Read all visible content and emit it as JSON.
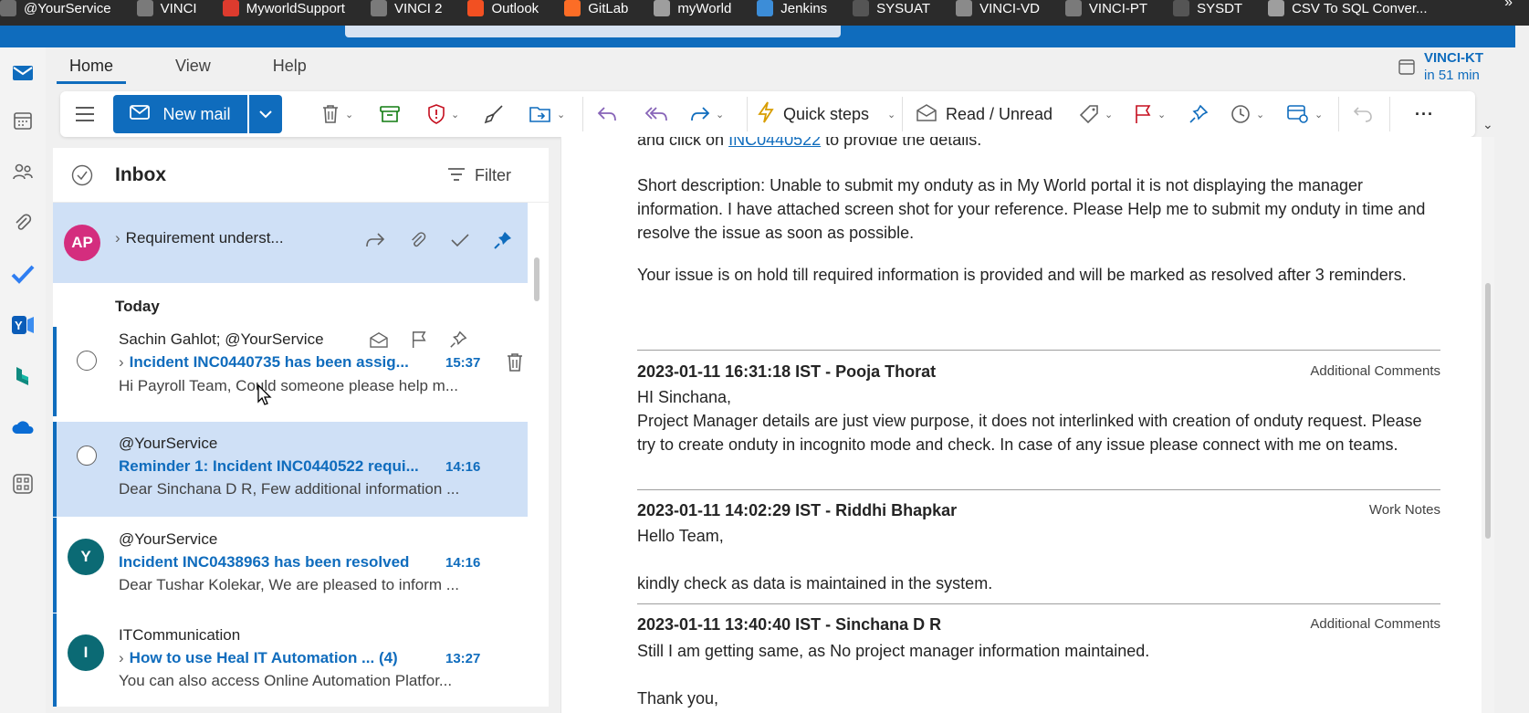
{
  "bookmarks": [
    {
      "label": "@YourService",
      "color": "#6e6e6e"
    },
    {
      "label": "VINCI",
      "color": "#7a7a7a"
    },
    {
      "label": "MyworldSupport",
      "color": "#dd3b2e"
    },
    {
      "label": "VINCI 2",
      "color": "#7a7a7a"
    },
    {
      "label": "Outlook",
      "color": "#f25022"
    },
    {
      "label": "GitLab",
      "color": "#fc6d26"
    },
    {
      "label": "myWorld",
      "color": "#9e9e9e"
    },
    {
      "label": "Jenkins",
      "color": "#3c8dd8"
    },
    {
      "label": "SYSUAT",
      "color": "#555555"
    },
    {
      "label": "VINCI-VD",
      "color": "#8a8a8a"
    },
    {
      "label": "VINCI-PT",
      "color": "#7a7a7a"
    },
    {
      "label": "SYSDT",
      "color": "#555555"
    },
    {
      "label": "CSV To SQL Conver...",
      "color": "#9e9e9e"
    }
  ],
  "bookmarks_more": "»",
  "ribbon": {
    "tabs": [
      "Home",
      "View",
      "Help"
    ],
    "active_tab": "Home",
    "new_mail_label": "New mail",
    "quick_steps_label": "Quick steps",
    "read_unread_label": "Read / Unread",
    "more_label": "···"
  },
  "reminder": {
    "title": "VINCI-KT",
    "time": "in 51 min"
  },
  "list": {
    "folder_title": "Inbox",
    "filter_label": "Filter",
    "pinned": {
      "initials": "AP",
      "avatar_color": "#d42d7e",
      "subject": "Requirement underst..."
    },
    "group_label": "Today",
    "messages": [
      {
        "sender": "Sachin Gahlot; @YourService",
        "subject": "Incident INC0440735 has been assig...",
        "time": "15:37",
        "preview": "Hi Payroll Team, Could someone please help m...",
        "has_expand": true
      },
      {
        "sender": "@YourService",
        "subject": "Reminder 1: Incident INC0440522 requi...",
        "time": "14:16",
        "preview": "Dear Sinchana D R, Few additional information ...",
        "has_expand": false
      },
      {
        "sender": "@YourService",
        "subject": "Incident INC0438963 has been resolved",
        "time": "14:16",
        "preview": "Dear Tushar Kolekar, We are pleased to inform ...",
        "initials": "Y",
        "avatar_color": "#0b6a74",
        "has_expand": false
      },
      {
        "sender": "ITCommunication",
        "subject": "How to use Heal IT Automation ... (4)",
        "time": "13:27",
        "preview": "You can also access Online Automation Platfor...",
        "initials": "I",
        "avatar_color": "#0b6a74",
        "has_expand": true
      }
    ]
  },
  "reading": {
    "top_line_prefix": "and click on",
    "top_line_link": "INC0440522",
    "top_line_suffix": "to provide the details.",
    "short_description": "Short description: Unable to submit my onduty as in My World portal it is not displaying the manager information. I have attached screen shot for your reference. Please Help me to submit my onduty in time and resolve the issue as soon as possible.",
    "hold_notice": "Your issue is on hold till required information is provided and will be marked as resolved after 3 reminders.",
    "entries": [
      {
        "header": "2023-01-11 16:31:18 IST - Pooja Thorat",
        "type": "Additional Comments",
        "lines": [
          "HI Sinchana,",
          "Project Manager details are just view purpose, it does not interlinked with creation of onduty request. Please try to create onduty in incognito mode and check. In case of any issue please connect with me on teams."
        ]
      },
      {
        "header": "2023-01-11 14:02:29 IST - Riddhi Bhapkar",
        "type": "Work Notes",
        "lines": [
          "Hello Team,",
          "kindly check as data is maintained in the system."
        ]
      },
      {
        "header": "2023-01-11 13:40:40 IST - Sinchana D R",
        "type": "Additional Comments",
        "lines": [
          "Still I am getting same, as No project manager information maintained.",
          "Thank you,"
        ]
      }
    ]
  },
  "colors": {
    "accent": "#0f6cbd",
    "selected_row": "#cfe0f6",
    "header_bar": "#2b2b2b"
  }
}
